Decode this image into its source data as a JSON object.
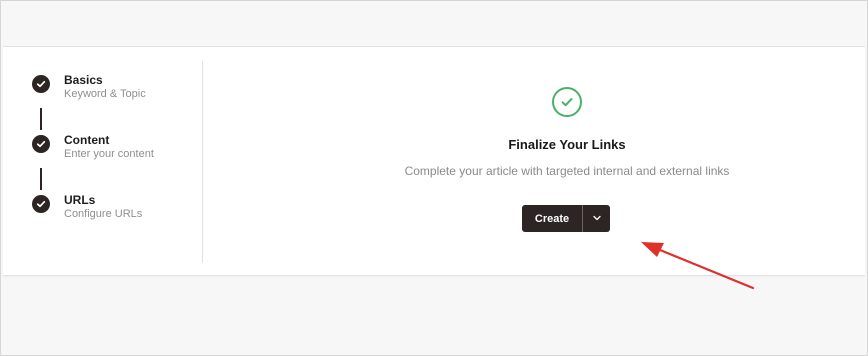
{
  "steps": [
    {
      "title": "Basics",
      "subtitle": "Keyword & Topic"
    },
    {
      "title": "Content",
      "subtitle": "Enter your content"
    },
    {
      "title": "URLs",
      "subtitle": "Configure URLs"
    }
  ],
  "main": {
    "title": "Finalize Your Links",
    "subtitle": "Complete your article with targeted internal and external links",
    "create_label": "Create",
    "status_icon": "check-circle-icon",
    "caret_icon": "chevron-down-icon"
  },
  "colors": {
    "dark": "#2c2523",
    "success": "#4caf67",
    "annotation_arrow": "#e0302a"
  }
}
